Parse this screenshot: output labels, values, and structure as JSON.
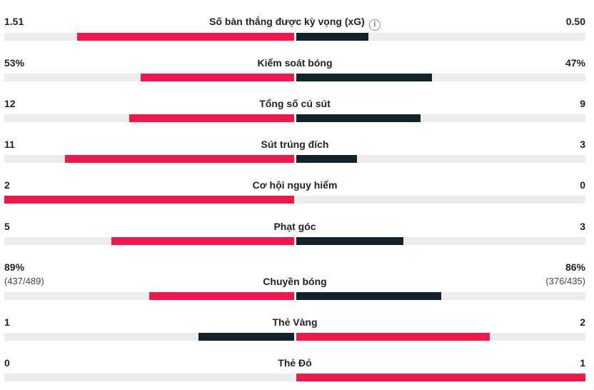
{
  "colors": {
    "home": "#f2164a",
    "away": "#11222b",
    "track": "#ececec"
  },
  "info_icon": "info-icon",
  "stats": [
    {
      "label": "Số bàn thắng được kỳ vọng (xG)",
      "home": "1.51",
      "away": "0.50",
      "home_fill": 0.75,
      "away_fill": 0.25,
      "home_color": "#f2164a",
      "away_color": "#11222b",
      "info": true
    },
    {
      "label": "Kiểm soát bóng",
      "home": "53%",
      "away": "47%",
      "home_fill": 0.53,
      "away_fill": 0.47,
      "home_color": "#f2164a",
      "away_color": "#11222b"
    },
    {
      "label": "Tổng số cú sút",
      "home": "12",
      "away": "9",
      "home_fill": 0.57,
      "away_fill": 0.43,
      "home_color": "#f2164a",
      "away_color": "#11222b"
    },
    {
      "label": "Sút trúng đích",
      "home": "11",
      "away": "3",
      "home_fill": 0.79,
      "away_fill": 0.21,
      "home_color": "#f2164a",
      "away_color": "#11222b"
    },
    {
      "label": "Cơ hội nguy hiểm",
      "home": "2",
      "away": "0",
      "home_fill": 1.0,
      "away_fill": 0.0,
      "home_color": "#f2164a",
      "away_color": "#11222b"
    },
    {
      "label": "Phạt góc",
      "home": "5",
      "away": "3",
      "home_fill": 0.63,
      "away_fill": 0.37,
      "home_color": "#f2164a",
      "away_color": "#11222b"
    },
    {
      "label": "Chuyền bóng",
      "home": "89%",
      "away": "86%",
      "home_sub": "(437/489)",
      "away_sub": "(376/435)",
      "home_fill": 0.5,
      "away_fill": 0.5,
      "home_color": "#f2164a",
      "away_color": "#11222b"
    },
    {
      "label": "Thẻ Vàng",
      "home": "1",
      "away": "2",
      "home_fill": 0.33,
      "away_fill": 0.67,
      "home_color": "#11222b",
      "away_color": "#f2164a"
    },
    {
      "label": "Thẻ Đỏ",
      "home": "0",
      "away": "1",
      "home_fill": 0.0,
      "away_fill": 1.0,
      "home_color": "#11222b",
      "away_color": "#f2164a"
    }
  ]
}
